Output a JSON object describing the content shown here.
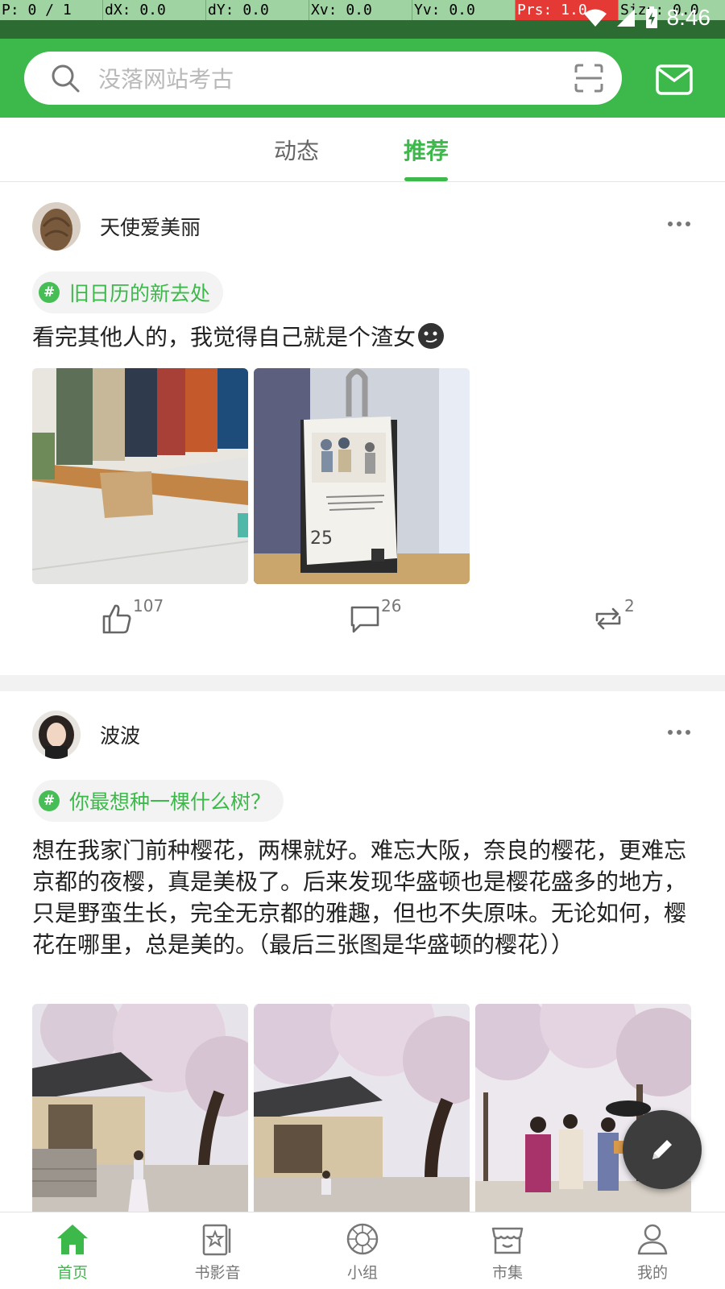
{
  "debug": {
    "p": "P: 0 / 1",
    "dx": "dX: 0.0",
    "dy": "dY: 0.0",
    "xv": "Xv: 0.0",
    "yv": "Yv: 0.0",
    "prs": "Prs: 1.0",
    "size": "Size: 0.0"
  },
  "status": {
    "time": "8:46"
  },
  "search": {
    "placeholder": "没落网站考古"
  },
  "tabs": [
    {
      "label": "动态",
      "active": false
    },
    {
      "label": "推荐",
      "active": true
    }
  ],
  "posts": [
    {
      "user": "天使爱美丽",
      "topic": "旧日历的新去处",
      "text": "看完其他人的，我觉得自己就是个渣女",
      "likes": "107",
      "comments": "26",
      "reposts": "2",
      "calendar_day": "25"
    },
    {
      "user": "波波",
      "topic": "你最想种一棵什么树？",
      "text": "想在我家门前种樱花，两棵就好。难忘大阪，奈良的樱花，更难忘京都的夜樱，真是美极了。后来发现华盛顿也是樱花盛多的地方，只是野蛮生长，完全无京都的雅趣，但也不失原味。无论如何，樱花在哪里，总是美的。（最后三张图是华盛顿的樱花））"
    }
  ],
  "bottom_nav": [
    {
      "label": "首页",
      "icon": "home-icon",
      "active": true
    },
    {
      "label": "书影音",
      "icon": "book-icon",
      "active": false
    },
    {
      "label": "小组",
      "icon": "group-icon",
      "active": false
    },
    {
      "label": "市集",
      "icon": "market-icon",
      "active": false
    },
    {
      "label": "我的",
      "icon": "profile-icon",
      "active": false
    }
  ],
  "colors": {
    "brand_green": "#3cb94a",
    "status_bar": "#2c6b31",
    "fab": "#3d3d3d"
  }
}
